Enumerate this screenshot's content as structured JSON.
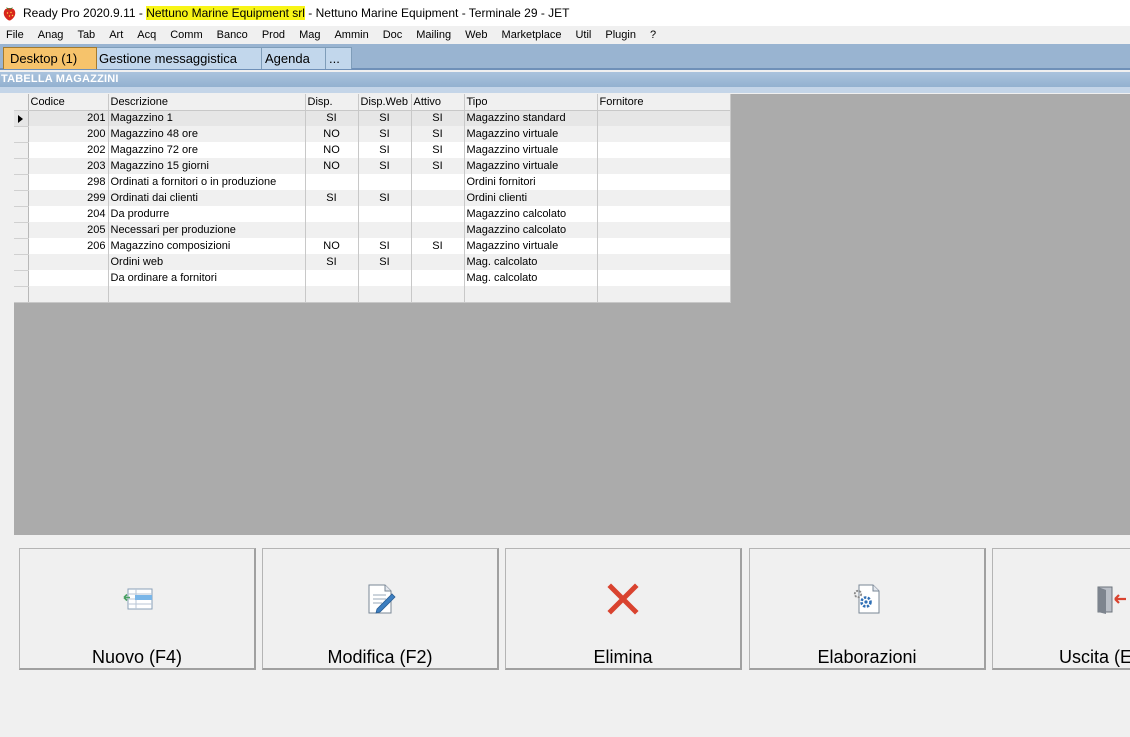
{
  "titlebar": {
    "app_name": "Ready Pro 2020.9.11",
    "separator": " - ",
    "company": "Nettuno Marine Equipment srl",
    "rest": " - Nettuno Marine Equipment - Terminale 29 - JET"
  },
  "menu": [
    "File",
    "Anag",
    "Tab",
    "Art",
    "Acq",
    "Comm",
    "Banco",
    "Prod",
    "Mag",
    "Ammin",
    "Doc",
    "Mailing",
    "Web",
    "Marketplace",
    "Util",
    "Plugin",
    "?"
  ],
  "tabs": [
    {
      "label": "Desktop (1)",
      "active": true
    },
    {
      "label": "Gestione messaggistica",
      "active": false
    },
    {
      "label": "Agenda",
      "active": false
    },
    {
      "label": "...",
      "active": false
    }
  ],
  "section_title": "TABELLA MAGAZZINI",
  "table": {
    "columns": [
      "Codice",
      "Descrizione",
      "Disp.",
      "Disp.Web",
      "Attivo",
      "Tipo",
      "Fornitore"
    ],
    "rows": [
      {
        "codice": "201",
        "descrizione": "Magazzino 1",
        "disp": "SI",
        "disp_web": "SI",
        "attivo": "SI",
        "tipo": "Magazzino standard",
        "fornitore": ""
      },
      {
        "codice": "200",
        "descrizione": "Magazzino 48 ore",
        "disp": "NO",
        "disp_web": "SI",
        "attivo": "SI",
        "tipo": "Magazzino virtuale",
        "fornitore": ""
      },
      {
        "codice": "202",
        "descrizione": "Magazzino 72 ore",
        "disp": "NO",
        "disp_web": "SI",
        "attivo": "SI",
        "tipo": "Magazzino virtuale",
        "fornitore": ""
      },
      {
        "codice": "203",
        "descrizione": "Magazzino 15 giorni",
        "disp": "NO",
        "disp_web": "SI",
        "attivo": "SI",
        "tipo": "Magazzino virtuale",
        "fornitore": ""
      },
      {
        "codice": "298",
        "descrizione": "Ordinati a fornitori o in produzione",
        "disp": "",
        "disp_web": "",
        "attivo": "",
        "tipo": "Ordini fornitori",
        "fornitore": ""
      },
      {
        "codice": "299",
        "descrizione": "Ordinati dai clienti",
        "disp": "SI",
        "disp_web": "SI",
        "attivo": "",
        "tipo": "Ordini clienti",
        "fornitore": ""
      },
      {
        "codice": "204",
        "descrizione": "Da produrre",
        "disp": "",
        "disp_web": "",
        "attivo": "",
        "tipo": "Magazzino calcolato",
        "fornitore": ""
      },
      {
        "codice": "205",
        "descrizione": "Necessari per produzione",
        "disp": "",
        "disp_web": "",
        "attivo": "",
        "tipo": "Magazzino calcolato",
        "fornitore": ""
      },
      {
        "codice": "206",
        "descrizione": "Magazzino composizioni",
        "disp": "NO",
        "disp_web": "SI",
        "attivo": "SI",
        "tipo": "Magazzino virtuale",
        "fornitore": ""
      },
      {
        "codice": "",
        "descrizione": "Ordini web",
        "disp": "SI",
        "disp_web": "SI",
        "attivo": "",
        "tipo": "Mag. calcolato",
        "fornitore": ""
      },
      {
        "codice": "",
        "descrizione": "Da ordinare a fornitori",
        "disp": "",
        "disp_web": "",
        "attivo": "",
        "tipo": "Mag. calcolato",
        "fornitore": ""
      },
      {
        "codice": "",
        "descrizione": "",
        "disp": "",
        "disp_web": "",
        "attivo": "",
        "tipo": "",
        "fornitore": ""
      }
    ],
    "selected_row": 0
  },
  "buttons": [
    {
      "label": "Nuovo (F4)",
      "icon": "new-record-icon"
    },
    {
      "label": "Modifica (F2)",
      "icon": "edit-document-icon"
    },
    {
      "label": "Elimina",
      "icon": "delete-x-icon"
    },
    {
      "label": "Elaborazioni",
      "icon": "gear-document-icon"
    },
    {
      "label": "Uscita (E",
      "icon": "exit-door-icon"
    }
  ],
  "colors": {
    "title_highlight": "#f8f516",
    "tab_active": "#f6c36b",
    "tab_inactive": "#c2d7ec",
    "tab_strip": "#99b4d1",
    "delete_red": "#d9432f",
    "grid_background": "#ababab"
  }
}
